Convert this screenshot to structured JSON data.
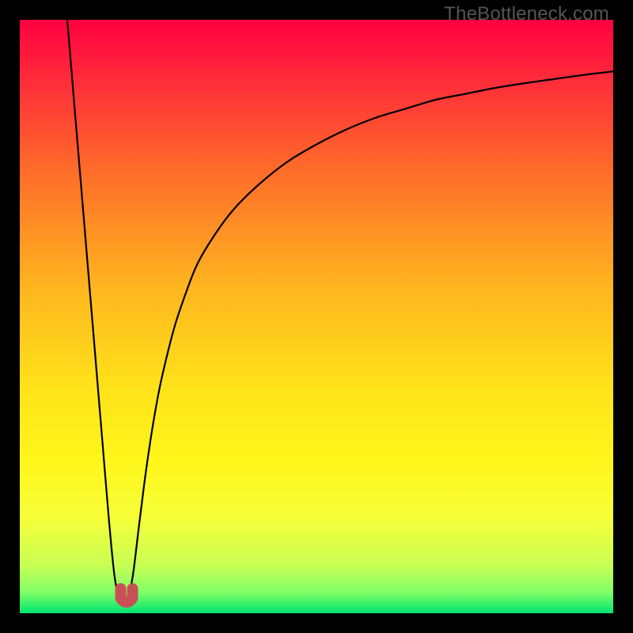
{
  "watermark": "TheBottleneck.com",
  "chart_data": {
    "type": "line",
    "title": "",
    "xlabel": "",
    "ylabel": "",
    "xlim": [
      0,
      100
    ],
    "ylim": [
      0,
      100
    ],
    "gradient_stops": [
      {
        "offset": 0.0,
        "color": "#ff0040"
      },
      {
        "offset": 0.1,
        "color": "#ff2b3a"
      },
      {
        "offset": 0.25,
        "color": "#ff6a2a"
      },
      {
        "offset": 0.45,
        "color": "#ffb51f"
      },
      {
        "offset": 0.62,
        "color": "#ffe21a"
      },
      {
        "offset": 0.74,
        "color": "#fff61a"
      },
      {
        "offset": 0.84,
        "color": "#f6ff39"
      },
      {
        "offset": 0.92,
        "color": "#c7ff54"
      },
      {
        "offset": 0.965,
        "color": "#7fff66"
      },
      {
        "offset": 1.0,
        "color": "#00e572"
      }
    ],
    "series": [
      {
        "name": "bottleneck-curve",
        "x": [
          8,
          9,
          10,
          11,
          12,
          13,
          14,
          15,
          16,
          17,
          18,
          19,
          20,
          21,
          22,
          23,
          24,
          26,
          28,
          30,
          33,
          36,
          40,
          45,
          50,
          55,
          60,
          65,
          70,
          75,
          80,
          85,
          90,
          95,
          100
        ],
        "y": [
          100,
          88,
          76,
          64,
          52,
          40,
          28,
          16,
          6,
          2,
          2,
          6,
          14,
          22,
          29,
          35,
          40,
          48,
          54,
          59,
          64,
          68,
          72,
          76,
          79,
          81.5,
          83.5,
          85,
          86.5,
          87.5,
          88.5,
          89.3,
          90,
          90.7,
          91.3
        ]
      }
    ],
    "marker": {
      "name": "bottleneck-minimum",
      "x_range": [
        17,
        19
      ],
      "y": 2,
      "color": "#c94f56"
    }
  }
}
